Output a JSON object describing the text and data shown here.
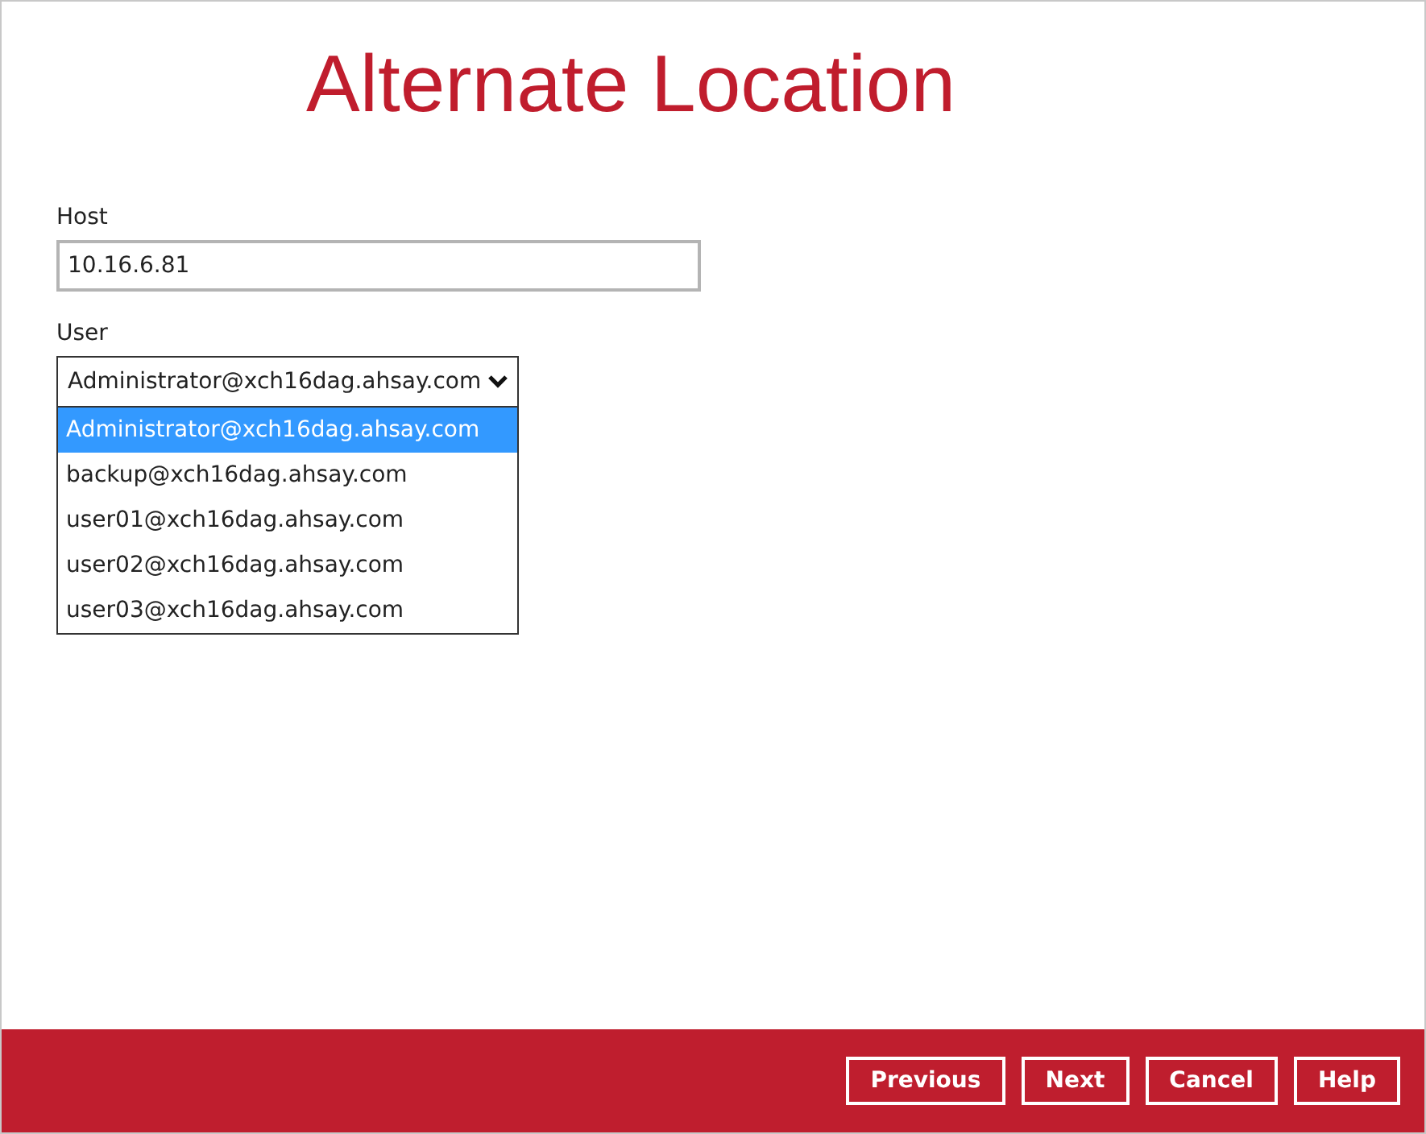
{
  "title": "Alternate Location",
  "host": {
    "label": "Host",
    "value": "10.16.6.81"
  },
  "user": {
    "label": "User",
    "value": "Administrator@xch16dag.ahsay.com",
    "expanded": true,
    "options": [
      {
        "label": "Administrator@xch16dag.ahsay.com",
        "selected": true
      },
      {
        "label": "backup@xch16dag.ahsay.com",
        "selected": false
      },
      {
        "label": "user01@xch16dag.ahsay.com",
        "selected": false
      },
      {
        "label": "user02@xch16dag.ahsay.com",
        "selected": false
      },
      {
        "label": "user03@xch16dag.ahsay.com",
        "selected": false
      }
    ]
  },
  "buttons": [
    "Previous",
    "Next",
    "Cancel",
    "Help"
  ]
}
